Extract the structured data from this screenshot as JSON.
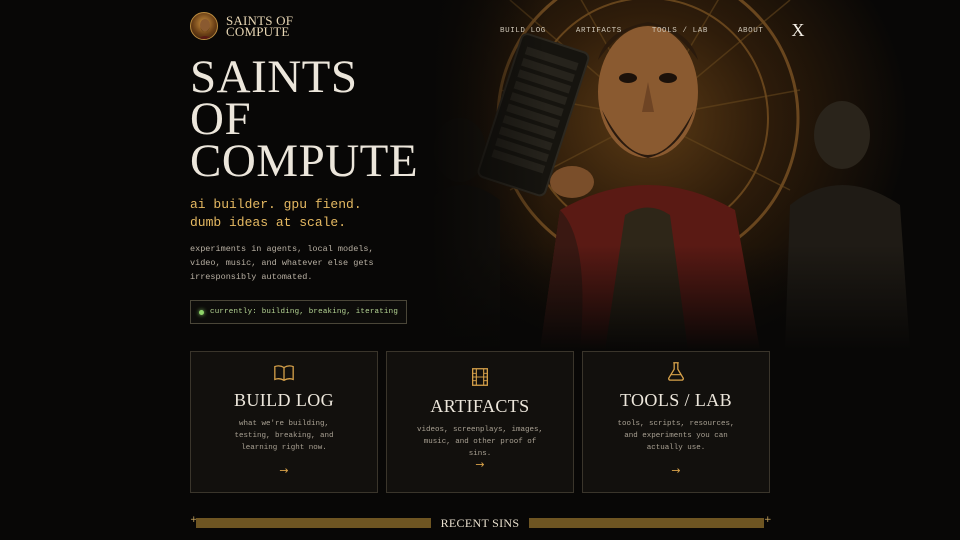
{
  "brand": {
    "name": "SAINTS OF COMPUTE"
  },
  "nav": {
    "items": [
      {
        "label": "BUILD LOG"
      },
      {
        "label": "ARTIFACTS"
      },
      {
        "label": "TOOLS / LAB"
      },
      {
        "label": "ABOUT"
      }
    ],
    "x_label": "X"
  },
  "hero": {
    "title_lines": [
      "SAINTS",
      "OF",
      "COMPUTE"
    ],
    "tagline_lines": [
      "ai builder. gpu fiend.",
      "dumb ideas at scale."
    ],
    "description": "experiments in agents, local models, video, music, and whatever else gets irresponsibly automated.",
    "status": "currently: building, breaking, iterating"
  },
  "cards": [
    {
      "title": "BUILD LOG",
      "description": "what we're building, testing, breaking, and learning right now.",
      "icon": "book-icon",
      "arrow": "→"
    },
    {
      "title": "ARTIFACTS",
      "description": "videos, screenplays, images, music, and other proof of sins.",
      "icon": "film-icon",
      "arrow": "→"
    },
    {
      "title": "TOOLS / LAB",
      "description": "tools, scripts, resources, and experiments you can actually use.",
      "icon": "flask-icon",
      "arrow": "→"
    }
  ],
  "recent": {
    "label": "RECENT SINS",
    "plus": "+"
  },
  "colors": {
    "accent": "#e5b962",
    "status": "#8fd46a",
    "bar": "#6e5522"
  }
}
